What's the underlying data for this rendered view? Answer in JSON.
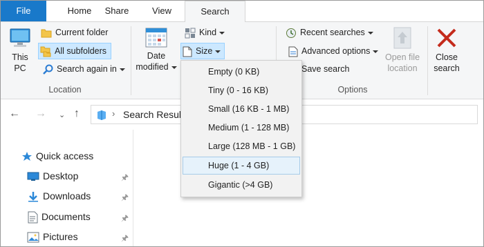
{
  "tabs": [
    "File",
    "Home",
    "Share",
    "View",
    "Search"
  ],
  "ribbon": {
    "this_pc": [
      "This",
      "PC"
    ],
    "current_folder": "Current folder",
    "all_subfolders": "All subfolders",
    "search_again_in": "Search again in",
    "location_label": "Location",
    "date_modified": [
      "Date",
      "modified"
    ],
    "kind": "Kind",
    "size": "Size",
    "recent_searches": "Recent searches",
    "advanced_options": "Advanced options",
    "save_search": "Save search",
    "options_label": "Options",
    "open_file_location": [
      "Open file",
      "location"
    ],
    "close_search": [
      "Close",
      "search"
    ]
  },
  "address": {
    "path": "Search Result"
  },
  "size_menu": [
    "Empty (0 KB)",
    "Tiny (0 - 16 KB)",
    "Small (16 KB - 1 MB)",
    "Medium (1 - 128 MB)",
    "Large (128 MB - 1 GB)",
    "Huge (1 - 4 GB)",
    "Gigantic (>4 GB)"
  ],
  "navpane": {
    "quick_access": "Quick access",
    "items": [
      "Desktop",
      "Downloads",
      "Documents",
      "Pictures"
    ]
  },
  "colors": {
    "file_tab": "#1979ca",
    "selected": "#cce8ff",
    "close_x": "#c42b1c"
  }
}
